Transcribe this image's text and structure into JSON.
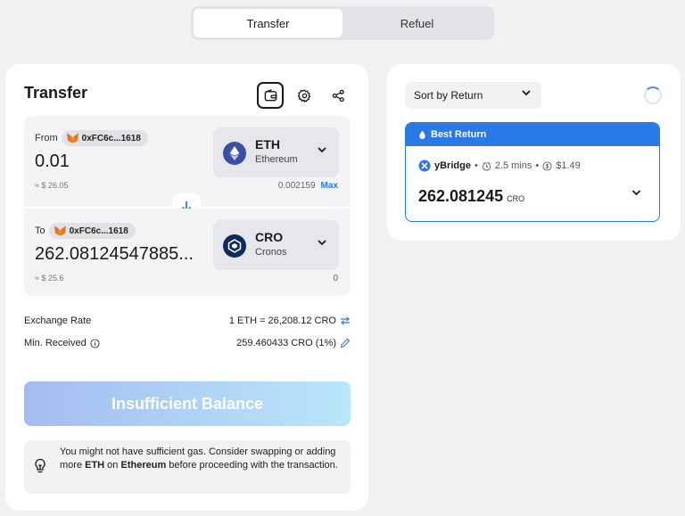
{
  "tabs": [
    {
      "label": "Transfer",
      "active": true
    },
    {
      "label": "Refuel",
      "active": false
    }
  ],
  "transfer": {
    "title": "Transfer",
    "from": {
      "label": "From",
      "address": "0xFC6c...1618",
      "amount": "0.01",
      "usd": "≈ $ 26.05",
      "balance": "0.002159",
      "max_label": "Max",
      "token": {
        "symbol": "ETH",
        "network": "Ethereum"
      }
    },
    "to": {
      "label": "To",
      "address": "0xFC6c...1618",
      "amount": "262.08124547885...",
      "usd": "≈ $ 25.6",
      "balance": "0",
      "token": {
        "symbol": "CRO",
        "network": "Cronos"
      }
    },
    "exchange_rate_label": "Exchange Rate",
    "exchange_rate_value": "1 ETH = 26,208.12 CRO",
    "min_received_label": "Min. Received",
    "min_received_value": "259.460433 CRO (1%)",
    "button_label": "Insufficient Balance",
    "warning": {
      "t1": "You might not have sufficient gas. Consider swapping or adding more ",
      "b1": "ETH",
      "t2": " on ",
      "b2": "Ethereum",
      "t3": " before proceeding with the transaction."
    }
  },
  "routes": {
    "sort_label": "Sort by Return",
    "best": {
      "badge": "Best Return",
      "provider": "yBridge",
      "sep": "•",
      "time": "2.5 mins",
      "fee": "$1.49",
      "amount": "262.081245",
      "unit": "CRO"
    }
  },
  "colors": {
    "accent": "#2b79e5",
    "eth": "#3d4fa0",
    "cro": "#0f2b5b"
  }
}
